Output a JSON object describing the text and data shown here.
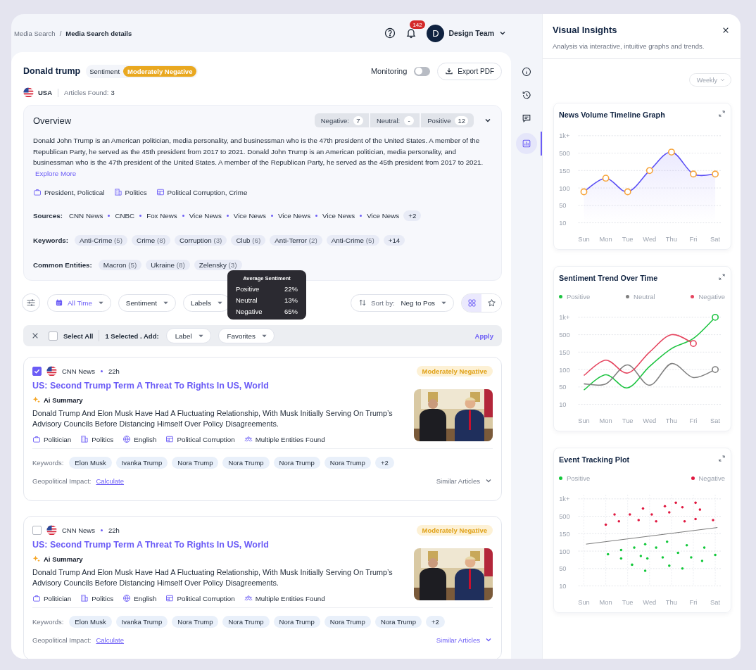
{
  "breadcrumbs": [
    {
      "label": "Media Search",
      "current": false
    },
    {
      "label": "Media Search details",
      "current": true
    }
  ],
  "breadcrumb_separator": "/",
  "header": {
    "notification_count": "142",
    "user_initial": "D",
    "user_name": "Design Team"
  },
  "entity": {
    "name": "Donald trump",
    "sentiment_label": "Sentiment",
    "sentiment": "Moderately Negative",
    "monitoring_label": "Monitoring",
    "monitoring": false,
    "export_label": "Export PDF",
    "country": "USA",
    "articles_label": "Articles Found:",
    "articles_count": "3"
  },
  "overview": {
    "title": "Overview",
    "expanded": true,
    "counts": [
      {
        "label": "Negative:",
        "value": "7"
      },
      {
        "label": "Neutral:",
        "value": "-"
      },
      {
        "label": "Positive",
        "value": "12"
      }
    ],
    "description": "Donald John Trump is an American politician, media personality, and businessman who is the 47th president of the United States. A member of the Republican Party, he served as the 45th president from 2017 to 2021. Donald John Trump is an American politician, media personality, and businessman who is the 47th president of the United States. A member of the Republican Party, he served as the 45th president from 2017 to 2021.",
    "explore_label": "Explore More",
    "tags": [
      {
        "kind": "briefcase",
        "label": "President, Polictical"
      },
      {
        "kind": "building",
        "label": "Politics"
      },
      {
        "kind": "table",
        "label": "Political Corruption, Crime"
      }
    ],
    "sources_label": "Sources:",
    "sources": [
      "CNN News",
      "CNBC",
      "Fox News",
      "Vice News",
      "Vice News",
      "Vice News",
      "Vice News",
      "Vice News"
    ],
    "sources_more": "+2",
    "keywords_label": "Keywords:",
    "keywords": [
      {
        "label": "Anti-Crime",
        "count": "(5)"
      },
      {
        "label": "Crime",
        "count": "(8)"
      },
      {
        "label": "Corruption",
        "count": "(3)"
      },
      {
        "label": "Club",
        "count": "(6)"
      },
      {
        "label": "Anti-Terror",
        "count": "(2)"
      },
      {
        "label": "Anti-Crime",
        "count": "(5)"
      }
    ],
    "keywords_more": "+14",
    "entities_label": "Common Entities:",
    "entities": [
      {
        "label": "Macron",
        "count": "(5)"
      },
      {
        "label": "Ukraine",
        "count": "(8)"
      },
      {
        "label": "Zelensky",
        "count": "(3)"
      }
    ]
  },
  "filters": {
    "items": [
      {
        "kind": "date",
        "label": "All Time"
      },
      {
        "kind": "plain",
        "label": "Sentiment"
      },
      {
        "kind": "plain",
        "label": "Labels"
      }
    ],
    "sort_label": "Sort by:",
    "sort_value": "Neg to Pos",
    "views": [
      {
        "kind": "grid",
        "selected": true
      },
      {
        "kind": "star",
        "selected": false
      }
    ]
  },
  "tooltip": {
    "title": "Average Sentiment",
    "rows": [
      {
        "label": "Positive",
        "value": "22%"
      },
      {
        "label": "Neutral",
        "value": "13%"
      },
      {
        "label": "Negative",
        "value": "65%"
      }
    ]
  },
  "selection_bar": {
    "select_all_label": "Select All",
    "select_all_checked": false,
    "selected_text": "1 Selected . Add:",
    "dropdowns": [
      "Label",
      "Favorites"
    ],
    "apply_label": "Apply"
  },
  "articles": [
    {
      "selected": true,
      "source": "CNN News",
      "age": "22h",
      "sentiment": "Moderately Negative",
      "title": "US: Second Trump Term A Threat To Rights In US, World",
      "summary_label": "Ai Summary",
      "summary": "Donald Trump And Elon Musk Have Had A Fluctuating Relationship, With Musk Initially Serving On Trump’s Advisory Councils Before Distancing Himself Over Policy Disagreements.",
      "tags": [
        {
          "kind": "briefcase",
          "label": "Politician"
        },
        {
          "kind": "building",
          "label": "Politics"
        },
        {
          "kind": "globe",
          "label": "English"
        },
        {
          "kind": "table",
          "label": "Political Corruption"
        },
        {
          "kind": "people",
          "label": "Multiple Entities Found"
        }
      ],
      "keywords_label": "Keywords:",
      "keywords": [
        "Elon Musk",
        "Ivanka Trump",
        "Nora Trump",
        "Nora Trump",
        "Nora Trump",
        "Nora Trump"
      ],
      "keywords_more": "+2",
      "impact_label": "Geopolitical Impact:",
      "impact_action": "Calculate",
      "similar_label": "Similar Articles",
      "similar_active": false
    },
    {
      "selected": false,
      "source": "CNN News",
      "age": "22h",
      "sentiment": "Moderately Negative",
      "title": "US: Second Trump Term A Threat To Rights In US, World",
      "summary_label": "Ai Summary",
      "summary": "Donald Trump And Elon Musk Have Had A Fluctuating Relationship, With Musk Initially Serving On Trump’s Advisory Councils Before Distancing Himself Over Policy Disagreements.",
      "tags": [
        {
          "kind": "briefcase",
          "label": "Politician"
        },
        {
          "kind": "building",
          "label": "Politics"
        },
        {
          "kind": "globe",
          "label": "English"
        },
        {
          "kind": "table",
          "label": "Political Corruption"
        },
        {
          "kind": "people",
          "label": "Multiple Entities Found"
        }
      ],
      "keywords_label": "Keywords:",
      "keywords": [
        "Elon Musk",
        "Ivanka Trump",
        "Nora Trump",
        "Nora Trump",
        "Nora Trump",
        "Nora Trump",
        "Nora Trump"
      ],
      "keywords_more": "+2",
      "impact_label": "Geopolitical Impact:",
      "impact_action": "Calculate",
      "similar_label": "Similar Articles",
      "similar_active": true
    }
  ],
  "rail": [
    {
      "kind": "info",
      "selected": false
    },
    {
      "kind": "history",
      "selected": false
    },
    {
      "kind": "chat",
      "selected": false
    },
    {
      "kind": "chart",
      "selected": true
    }
  ],
  "insights": {
    "title": "Visual Insights",
    "subtitle": "Analysis via interactive, intuitive graphs and trends.",
    "period": "Weekly",
    "charts": [
      {
        "kind": "area",
        "title": "News Volume Timeline Graph",
        "y_labels": [
          "1k+",
          "500",
          "150",
          "100",
          "50",
          "10"
        ],
        "x_labels": [
          "Sun",
          "Mon",
          "Tue",
          "Wed",
          "Thu",
          "Fri",
          "Sat"
        ]
      },
      {
        "kind": "line",
        "title": "Sentiment Trend Over Time",
        "legend": [
          {
            "name": "Positive",
            "color": "#1dc441"
          },
          {
            "name": "Neutral",
            "color": "#808080"
          },
          {
            "name": "Negative",
            "color": "#e5455f"
          }
        ],
        "y_labels": [
          "1k+",
          "500",
          "150",
          "100",
          "50",
          "10"
        ],
        "x_labels": [
          "Sun",
          "Mon",
          "Tue",
          "Wed",
          "Thu",
          "Fri",
          "Sat"
        ]
      },
      {
        "kind": "scatter",
        "title": "Event Tracking Plot",
        "legend": [
          {
            "name": "Positive",
            "color": "#12c83a"
          },
          {
            "name": "Negative",
            "color": "#e0173f"
          }
        ],
        "y_labels": [
          "1k+",
          "500",
          "150",
          "100",
          "50",
          "10"
        ],
        "x_labels": [
          "Sun",
          "Mon",
          "Tue",
          "Wed",
          "Thu",
          "Fri",
          "Sat"
        ]
      }
    ]
  }
}
